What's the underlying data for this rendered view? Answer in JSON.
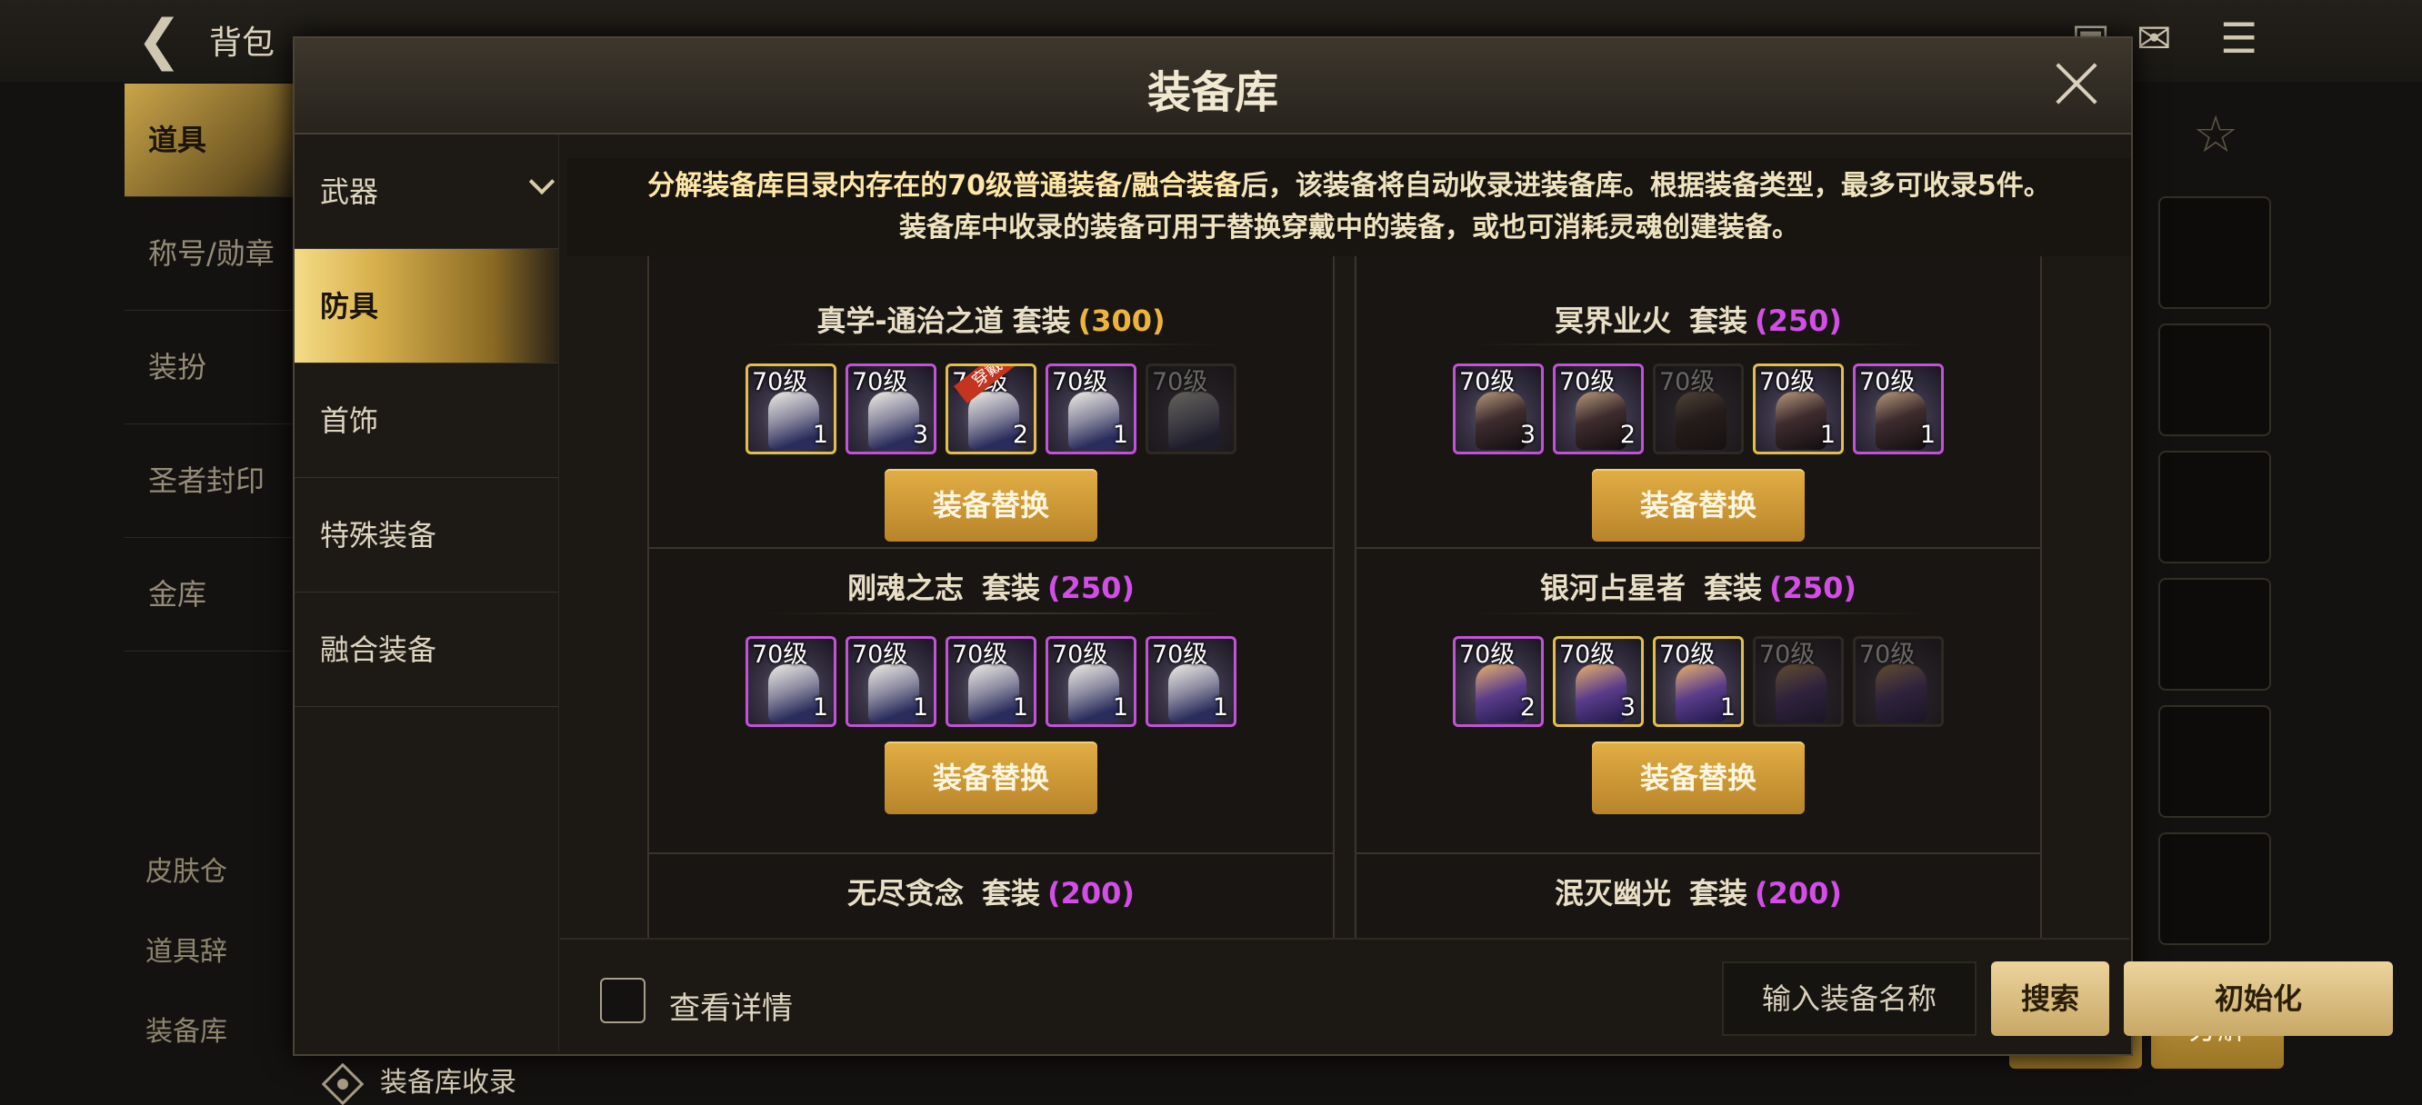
{
  "background": {
    "back_label": "背包",
    "sidebar": [
      "道具",
      "称号/勋章",
      "装扮",
      "圣者封印",
      "金库"
    ],
    "bottom_items": [
      "皮肤仓",
      "道具辞",
      "装备库"
    ],
    "disassemble_label": "分解"
  },
  "modal": {
    "title": "装备库",
    "categories": [
      {
        "label": "武器",
        "expanded": true
      },
      {
        "label": "防具",
        "selected": true
      },
      {
        "label": "首饰"
      },
      {
        "label": "特殊装备"
      },
      {
        "label": "融合装备"
      }
    ],
    "collect_label": "装备库收录",
    "notice_line1_strong": "分解装备库目录内存在的70级普通装备/融合装备",
    "notice_line1_rest": "后，该装备将自动收录进装备库。根据装备类型，最多可收录5件。",
    "notice_line2": "装备库中收录的装备可用于替换穿戴中的装备，或也可消耗灵魂创建装备。",
    "swap_label": "装备替换",
    "level_label": "70级",
    "equipped_label": "穿戴中",
    "sets": [
      {
        "name": "真学-通治之道",
        "suffix": "套装",
        "points": "(300)",
        "points_color": "#eeb43a",
        "items": [
          {
            "count": "1",
            "border": "gold",
            "style": "silver"
          },
          {
            "count": "3",
            "border": "purple",
            "style": "silver"
          },
          {
            "count": "2",
            "border": "gold",
            "style": "silver",
            "equipped": true
          },
          {
            "count": "1",
            "border": "purple",
            "style": "silver"
          },
          {
            "count": "",
            "border": "dim",
            "style": "silver"
          }
        ]
      },
      {
        "name": "冥界业火",
        "suffix": "套装",
        "points": "(250)",
        "points_color": "#d24ee7",
        "items": [
          {
            "count": "3",
            "border": "purple",
            "style": "dark"
          },
          {
            "count": "2",
            "border": "purple",
            "style": "dark"
          },
          {
            "count": "",
            "border": "dim",
            "style": "dark"
          },
          {
            "count": "1",
            "border": "gold",
            "style": "dark"
          },
          {
            "count": "1",
            "border": "purple",
            "style": "dark"
          }
        ]
      },
      {
        "name": "刚魂之志",
        "suffix": "套装",
        "points": "(250)",
        "points_color": "#d24ee7",
        "items": [
          {
            "count": "1",
            "border": "purple",
            "style": "silver"
          },
          {
            "count": "1",
            "border": "purple",
            "style": "silver"
          },
          {
            "count": "1",
            "border": "purple",
            "style": "silver"
          },
          {
            "count": "1",
            "border": "purple",
            "style": "silver"
          },
          {
            "count": "1",
            "border": "purple",
            "style": "silver"
          }
        ]
      },
      {
        "name": "银河占星者",
        "suffix": "套装",
        "points": "(250)",
        "points_color": "#d24ee7",
        "items": [
          {
            "count": "2",
            "border": "purple",
            "style": "purple"
          },
          {
            "count": "3",
            "border": "gold",
            "style": "purple"
          },
          {
            "count": "1",
            "border": "gold",
            "style": "purple"
          },
          {
            "count": "",
            "border": "dim",
            "style": "purple"
          },
          {
            "count": "",
            "border": "dim",
            "style": "purple"
          }
        ]
      },
      {
        "name": "无尽贪念",
        "suffix": "套装",
        "points": "(200)",
        "points_color": "#d24ee7",
        "items": []
      },
      {
        "name": "泯灭幽光",
        "suffix": "套装",
        "points": "(200)",
        "points_color": "#d24ee7",
        "items": []
      }
    ],
    "footer": {
      "details_label": "查看详情",
      "details_checked": false,
      "search_placeholder": "输入装备名称",
      "search_label": "搜索",
      "reset_label": "初始化"
    }
  }
}
